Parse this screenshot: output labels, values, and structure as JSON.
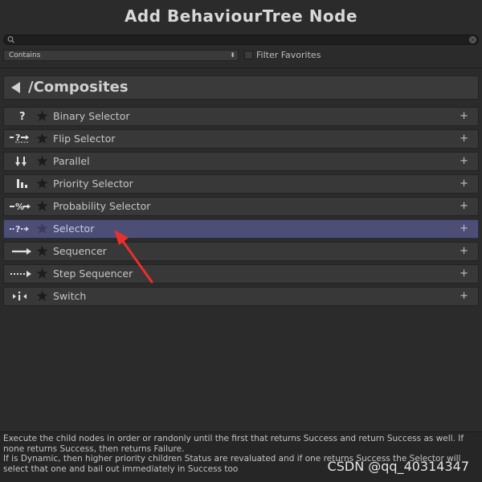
{
  "window": {
    "title": "Add BehaviourTree Node"
  },
  "search": {
    "value": "",
    "placeholder": ""
  },
  "filter": {
    "mode_value": "Contains",
    "favorites_label": "Filter Favorites",
    "favorites_checked": false
  },
  "header": {
    "title": "/Composites"
  },
  "nodes": [
    {
      "label": "Binary Selector",
      "icon": "binary-selector-icon",
      "add": "+",
      "selected": false
    },
    {
      "label": "Flip Selector",
      "icon": "flip-selector-icon",
      "add": "+",
      "selected": false
    },
    {
      "label": "Parallel",
      "icon": "parallel-icon",
      "add": "+",
      "selected": false
    },
    {
      "label": "Priority Selector",
      "icon": "priority-selector-icon",
      "add": "+",
      "selected": false
    },
    {
      "label": "Probability Selector",
      "icon": "probability-selector-icon",
      "add": "+",
      "selected": false
    },
    {
      "label": "Selector",
      "icon": "selector-icon",
      "add": "+",
      "selected": true
    },
    {
      "label": "Sequencer",
      "icon": "sequencer-icon",
      "add": "+",
      "selected": false
    },
    {
      "label": "Step Sequencer",
      "icon": "step-sequencer-icon",
      "add": "+",
      "selected": false
    },
    {
      "label": "Switch",
      "icon": "switch-icon",
      "add": "+",
      "selected": false
    }
  ],
  "description": {
    "line1": "Execute the child nodes in order or randonly until the first that returns Success and return Success as well. If none returns Success, then returns Failure.",
    "line2": "If is Dynamic, then higher priority children Status are revaluated and if one returns Success the Selector will select that one and bail out immediately in Success too"
  },
  "watermark": "CSDN @qq_40314347",
  "colors": {
    "background": "#2b2b2b",
    "row": "#383838",
    "selected_row": "#4c4e76",
    "annotation_arrow": "#e8302c"
  }
}
